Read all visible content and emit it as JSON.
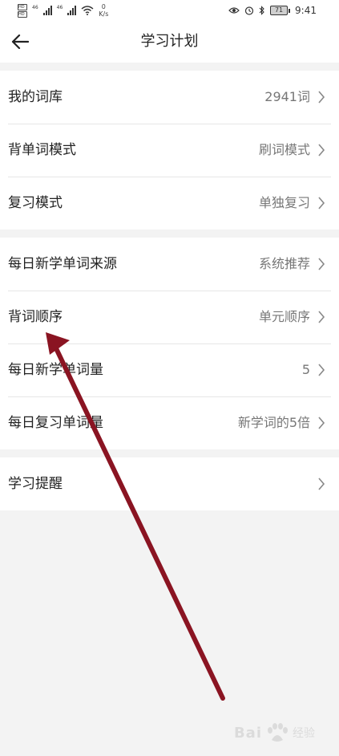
{
  "status_bar": {
    "net_type_1": "46",
    "net_type_2": "46",
    "sim_1": "HD",
    "sim_2": "HD",
    "speed_value": "0",
    "speed_unit": "K/s",
    "battery": "71",
    "time": "9:41"
  },
  "header": {
    "title": "学习计划"
  },
  "groups": [
    {
      "items": [
        {
          "label": "我的词库",
          "value": "2941词"
        },
        {
          "label": "背单词模式",
          "value": "刷词模式"
        },
        {
          "label": "复习模式",
          "value": "单独复习"
        }
      ]
    },
    {
      "items": [
        {
          "label": "每日新学单词来源",
          "value": "系统推荐"
        },
        {
          "label": "背词顺序",
          "value": "单元顺序"
        },
        {
          "label": "每日新学单词量",
          "value": "5"
        },
        {
          "label": "每日复习单词量",
          "value": "新学词的5倍"
        }
      ]
    },
    {
      "items": [
        {
          "label": "学习提醒",
          "value": ""
        }
      ]
    }
  ],
  "annotation": {
    "color": "#8a1422"
  },
  "watermark": {
    "brand": "Bai",
    "brand_suffix": "经验"
  },
  "colors": {
    "background": "#f3f3f3",
    "card": "#ffffff",
    "divider": "#e6e6e6",
    "label": "#222222",
    "value": "#777777"
  }
}
